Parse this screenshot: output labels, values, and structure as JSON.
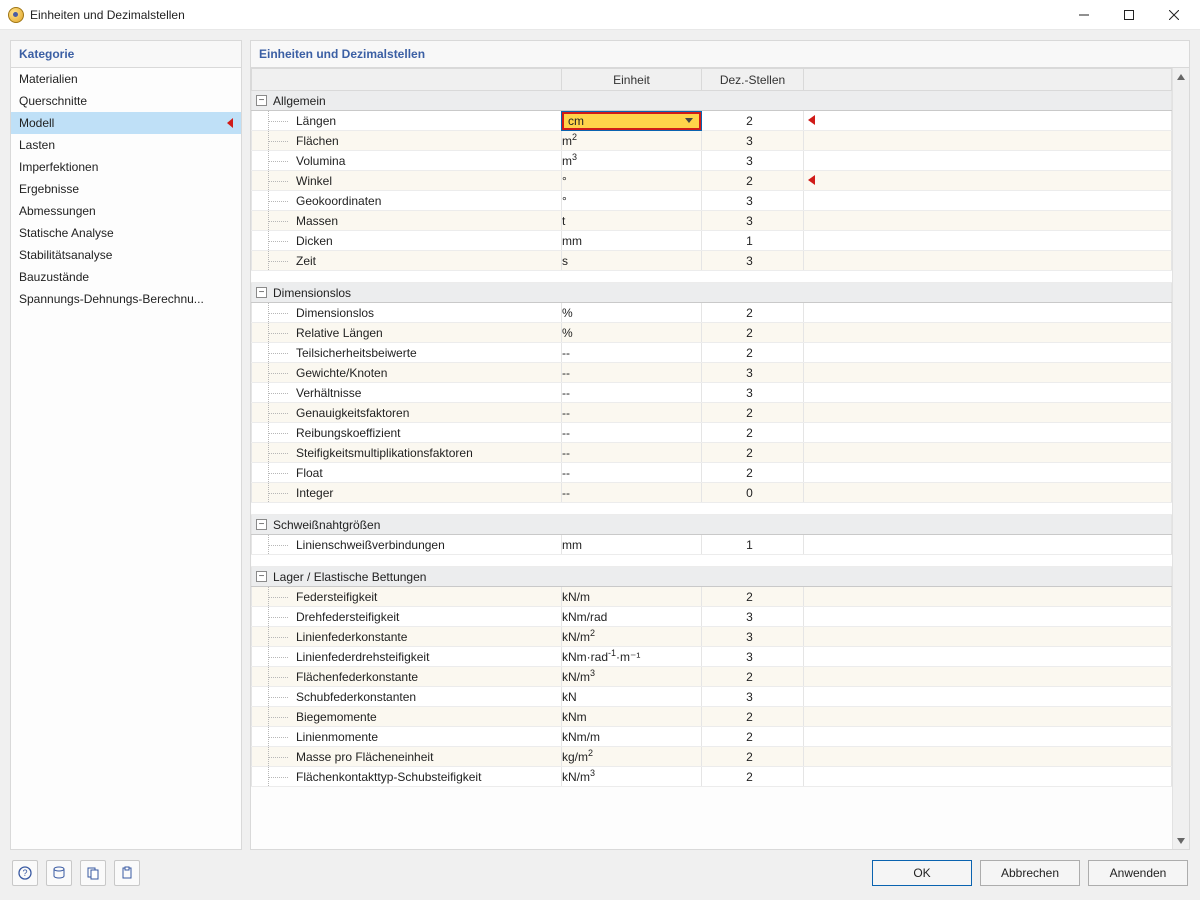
{
  "window": {
    "title": "Einheiten und Dezimalstellen"
  },
  "sidebar": {
    "header": "Kategorie",
    "items": [
      {
        "label": "Materialien",
        "selected": false
      },
      {
        "label": "Querschnitte",
        "selected": false
      },
      {
        "label": "Modell",
        "selected": true
      },
      {
        "label": "Lasten",
        "selected": false
      },
      {
        "label": "Imperfektionen",
        "selected": false
      },
      {
        "label": "Ergebnisse",
        "selected": false
      },
      {
        "label": "Abmessungen",
        "selected": false
      },
      {
        "label": "Statische Analyse",
        "selected": false
      },
      {
        "label": "Stabilitätsanalyse",
        "selected": false
      },
      {
        "label": "Bauzustände",
        "selected": false
      },
      {
        "label": "Spannungs-Dehnungs-Berechnu...",
        "selected": false
      }
    ]
  },
  "main": {
    "title": "Einheiten und Dezimalstellen",
    "columns": {
      "name": "",
      "unit": "Einheit",
      "dec": "Dez.-Stellen"
    },
    "groups": [
      {
        "label": "Allgemein",
        "rows": [
          {
            "name": "Längen",
            "unit": "cm",
            "dec": "2",
            "active": true,
            "mark": true
          },
          {
            "name": "Flächen",
            "unit": "m²",
            "dec": "3"
          },
          {
            "name": "Volumina",
            "unit": "m³",
            "dec": "3"
          },
          {
            "name": "Winkel",
            "unit": "°",
            "dec": "2",
            "mark": true
          },
          {
            "name": "Geokoordinaten",
            "unit": "°",
            "dec": "3"
          },
          {
            "name": "Massen",
            "unit": "t",
            "dec": "3"
          },
          {
            "name": "Dicken",
            "unit": "mm",
            "dec": "1"
          },
          {
            "name": "Zeit",
            "unit": "s",
            "dec": "3"
          }
        ]
      },
      {
        "label": "Dimensionslos",
        "rows": [
          {
            "name": "Dimensionslos",
            "unit": "%",
            "dec": "2"
          },
          {
            "name": "Relative Längen",
            "unit": "%",
            "dec": "2"
          },
          {
            "name": "Teilsicherheitsbeiwerte",
            "unit": "--",
            "dec": "2"
          },
          {
            "name": "Gewichte/Knoten",
            "unit": "--",
            "dec": "3"
          },
          {
            "name": "Verhältnisse",
            "unit": "--",
            "dec": "3"
          },
          {
            "name": "Genauigkeitsfaktoren",
            "unit": "--",
            "dec": "2"
          },
          {
            "name": "Reibungskoeffizient",
            "unit": "--",
            "dec": "2"
          },
          {
            "name": "Steifigkeitsmultiplikationsfaktoren",
            "unit": "--",
            "dec": "2"
          },
          {
            "name": "Float",
            "unit": "--",
            "dec": "2"
          },
          {
            "name": "Integer",
            "unit": "--",
            "dec": "0"
          }
        ]
      },
      {
        "label": "Schweißnahtgrößen",
        "rows": [
          {
            "name": "Linienschweißverbindungen",
            "unit": "mm",
            "dec": "1"
          }
        ]
      },
      {
        "label": "Lager / Elastische Bettungen",
        "rows": [
          {
            "name": "Federsteifigkeit",
            "unit": "kN/m",
            "dec": "2"
          },
          {
            "name": "Drehfedersteifigkeit",
            "unit": "kNm/rad",
            "dec": "3"
          },
          {
            "name": "Linienfederkonstante",
            "unit": "kN/m²",
            "dec": "3"
          },
          {
            "name": "Linienfederdrehsteifigkeit",
            "unit": "kNm·rad⁻¹·m⁻¹",
            "dec": "3"
          },
          {
            "name": "Flächenfederkonstante",
            "unit": "kN/m³",
            "dec": "2"
          },
          {
            "name": "Schubfederkonstanten",
            "unit": "kN",
            "dec": "3"
          },
          {
            "name": "Biegemomente",
            "unit": "kNm",
            "dec": "2"
          },
          {
            "name": "Linienmomente",
            "unit": "kNm/m",
            "dec": "2"
          },
          {
            "name": "Masse pro Flächeneinheit",
            "unit": "kg/m²",
            "dec": "2"
          },
          {
            "name": "Flächenkontakttyp-Schubsteifigkeit",
            "unit": "kN/m³",
            "dec": "2"
          }
        ]
      }
    ]
  },
  "footer": {
    "buttons": {
      "ok": "OK",
      "cancel": "Abbrechen",
      "apply": "Anwenden"
    }
  }
}
